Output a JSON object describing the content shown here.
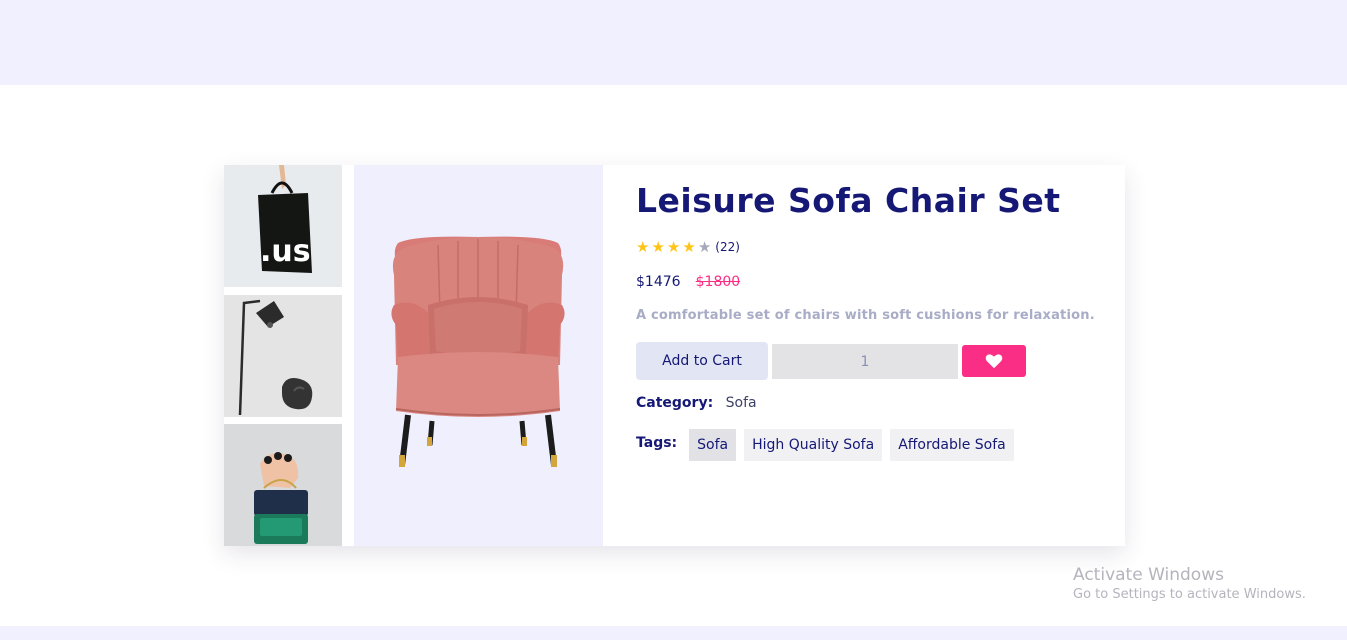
{
  "product": {
    "title": "Leisure Sofa Chair Set",
    "rating": {
      "filled": 4,
      "total": 5,
      "reviews": "(22)"
    },
    "price": "$1476",
    "old_price": "$1800",
    "description": "A comfortable set of chairs with soft cushions for relaxation.",
    "add_to_cart_label": "Add to Cart",
    "quantity": "1",
    "category_label": "Category:",
    "category_value": "Sofa",
    "tags_label": "Tags:",
    "tags": [
      "Sofa",
      "High Quality Sofa",
      "Affordable Sofa"
    ],
    "thumb_bag_text": ".us"
  },
  "icons": {
    "wishlist": "heart-icon",
    "star": "star-icon"
  },
  "colors": {
    "navy": "#151875",
    "pink": "#fb2e86",
    "star": "#ffc416",
    "lavender": "#f0f0fe"
  },
  "watermark": {
    "title": "Activate Windows",
    "subtitle": "Go to Settings to activate Windows."
  }
}
